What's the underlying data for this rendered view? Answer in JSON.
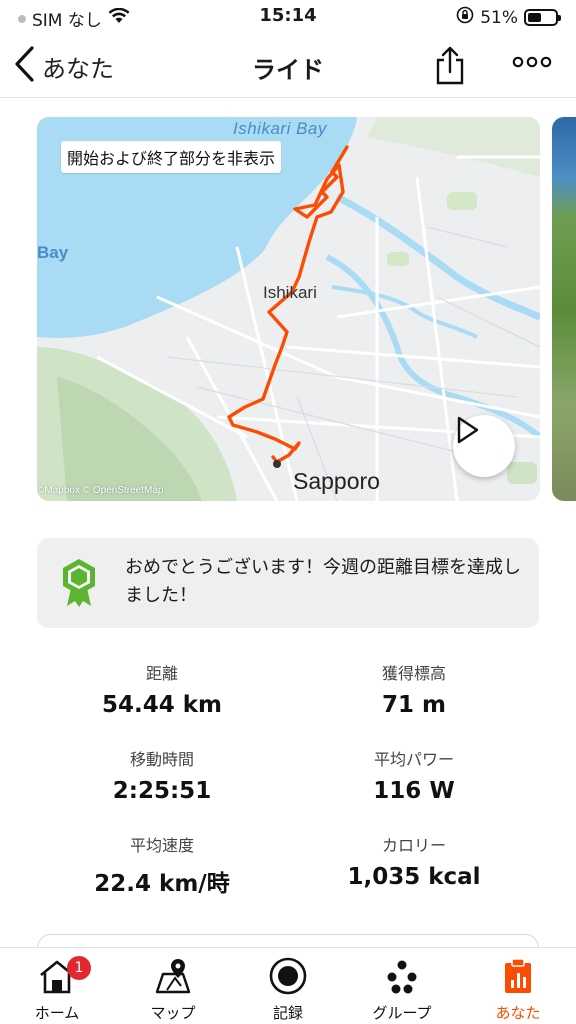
{
  "status_bar": {
    "carrier": "SIM なし",
    "time": "15:14",
    "battery_percent": "51%",
    "battery_level": 0.51
  },
  "nav": {
    "back_label": "あなた",
    "title": "ライド"
  },
  "map": {
    "hide_toggle_label": "開始および終了部分を非表示",
    "places": {
      "ishikari_bay": "Ishikari Bay",
      "bay": "Bay",
      "ishikari": "Ishikari",
      "sapporo": "Sapporo"
    },
    "attribution": "©Mapbox © OpenStreetMap",
    "route_color": "#fc4c02",
    "water_color": "#a9dcf4"
  },
  "achievement": {
    "message": "おめでとうございます！今週の距離目標を達成しました！",
    "badge_color": "#5cb531"
  },
  "stats": [
    {
      "label": "距離",
      "value": "54.44 km"
    },
    {
      "label": "獲得標高",
      "value": "71 m"
    },
    {
      "label": "移動時間",
      "value": "2:25:51"
    },
    {
      "label": "平均パワー",
      "value": "116 W"
    },
    {
      "label": "平均速度",
      "value": "22.4 km/時"
    },
    {
      "label": "カロリー",
      "value": "1,035 kcal"
    }
  ],
  "tabs": [
    {
      "label": "ホーム",
      "icon": "home-icon",
      "badge": "1"
    },
    {
      "label": "マップ",
      "icon": "map-icon"
    },
    {
      "label": "記録",
      "icon": "record-icon"
    },
    {
      "label": "グループ",
      "icon": "groups-icon"
    },
    {
      "label": "あなた",
      "icon": "you-icon",
      "active": true
    }
  ],
  "colors": {
    "accent": "#fc4c02",
    "notification": "#e0282e"
  }
}
